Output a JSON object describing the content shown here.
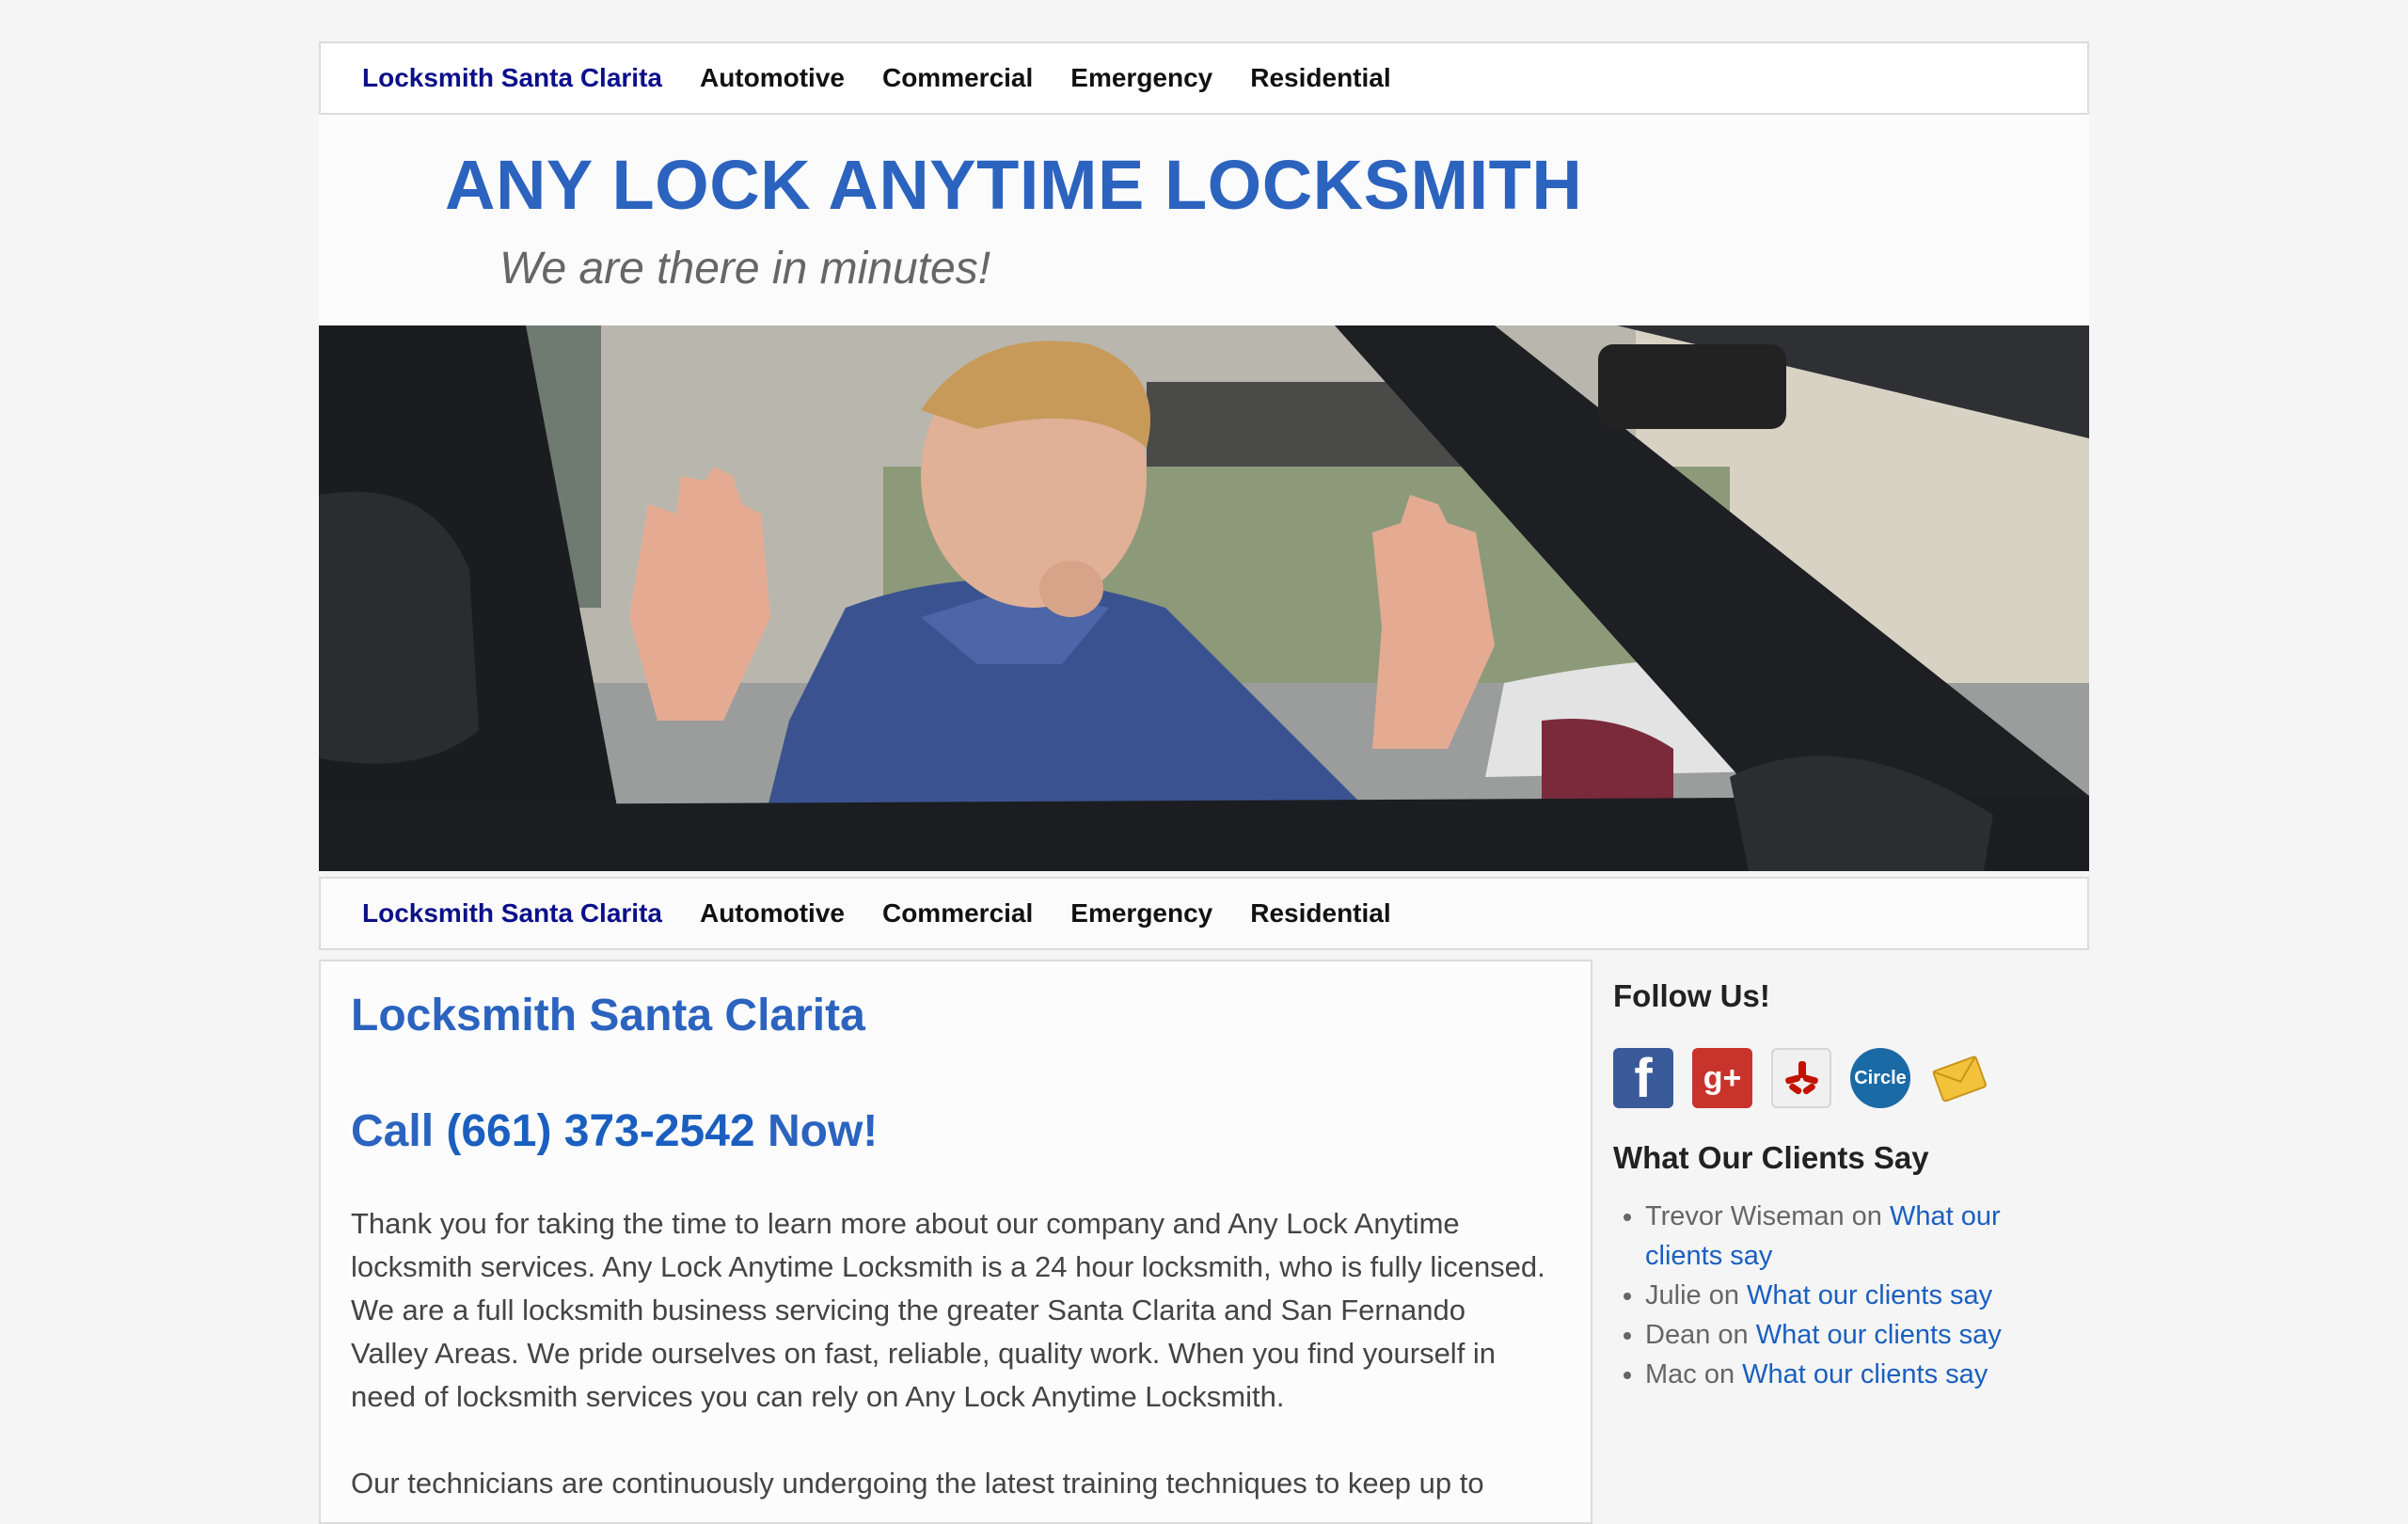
{
  "nav": {
    "items": [
      {
        "label": "Locksmith Santa Clarita"
      },
      {
        "label": "Automotive"
      },
      {
        "label": "Commercial"
      },
      {
        "label": "Emergency"
      },
      {
        "label": "Residential"
      }
    ]
  },
  "header": {
    "title": "ANY LOCK ANYTIME LOCKSMITH",
    "tagline": "We are there in minutes!"
  },
  "main": {
    "heading": "Locksmith Santa Clarita",
    "call_prefix": "Call ",
    "phone": "(661) 373-2542",
    "call_suffix": " Now!",
    "paragraph1": "Thank you for taking the time to learn more about our company and Any Lock Anytime locksmith services. Any Lock Anytime Locksmith is a 24 hour locksmith, who is fully licensed. We are a full locksmith business servicing the greater Santa Clarita and San Fernando Valley Areas. We pride ourselves on fast, reliable, quality work. When you find yourself in need of locksmith services you can rely on Any Lock Anytime Locksmith.",
    "paragraph2": "Our technicians are continuously undergoing the latest training techniques to keep up to"
  },
  "sidebar": {
    "follow_title": "Follow Us!",
    "social": {
      "facebook_glyph": "f",
      "gplus_glyph": "g+",
      "circle_label": "Circle"
    },
    "clients_title": "What Our Clients Say",
    "comments": [
      {
        "author": "Trevor Wiseman",
        "on": " on ",
        "link": "What our clients say"
      },
      {
        "author": "Julie",
        "on": " on ",
        "link": "What our clients say"
      },
      {
        "author": "Dean",
        "on": " on ",
        "link": "What our clients say"
      },
      {
        "author": "Mac",
        "on": " on ",
        "link": "What our clients say"
      }
    ]
  },
  "colors": {
    "title_blue": "#2b63bf",
    "link_blue": "#1a5fc0",
    "nav_current": "#0b0f8a"
  }
}
